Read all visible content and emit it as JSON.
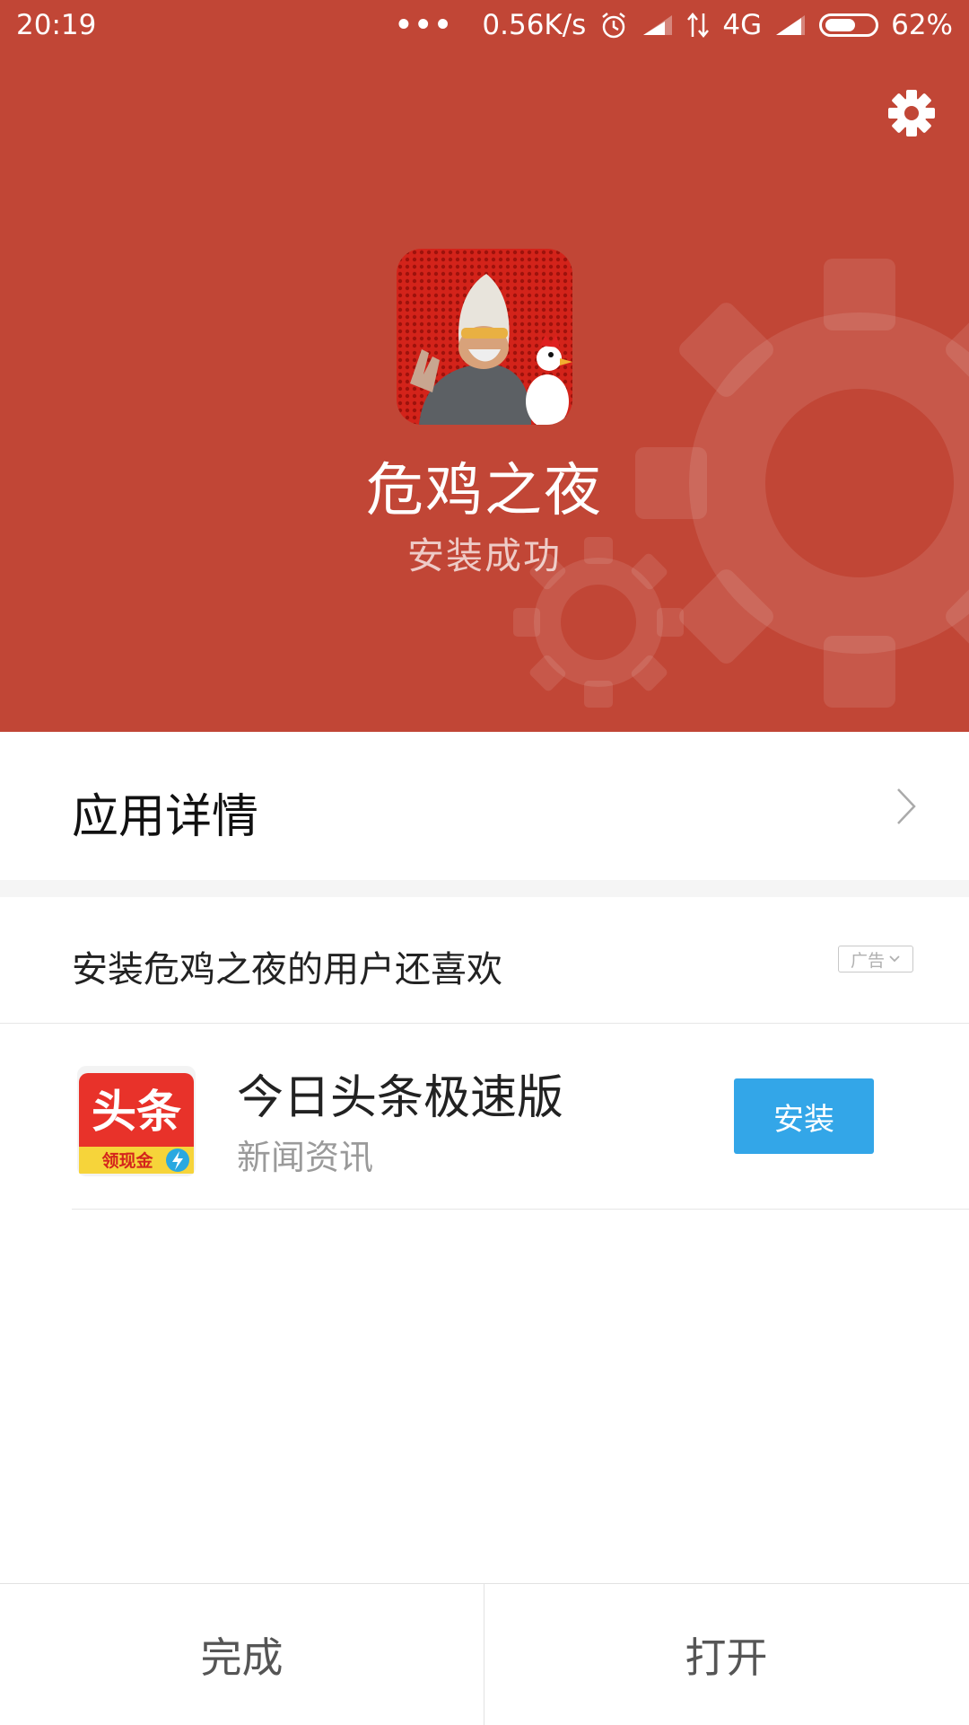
{
  "status_bar": {
    "time": "20:19",
    "dots": "•••",
    "net_speed": "0.56K/s",
    "network": "4G",
    "battery_percent": "62%",
    "battery_level": 0.62,
    "icons": [
      "alarm-icon",
      "signal-icon",
      "data-arrows-icon",
      "signal-icon",
      "battery-icon"
    ]
  },
  "header": {
    "settings_icon": "gear-icon",
    "app_name": "危鸡之夜",
    "status": "安装成功",
    "background_color": "#c14636"
  },
  "detail": {
    "label": "应用详情",
    "chevron_icon": "chevron-right-icon"
  },
  "recommendation": {
    "title": "安装危鸡之夜的用户还喜欢",
    "ad_label": "广告",
    "items": [
      {
        "name": "今日头条极速版",
        "category": "新闻资讯",
        "install_label": "安装",
        "icon_text": "头条",
        "icon_subtext": "领现金"
      }
    ]
  },
  "footer": {
    "done_label": "完成",
    "open_label": "打开"
  },
  "colors": {
    "accent": "#c14636",
    "install_button": "#33a6e8"
  }
}
